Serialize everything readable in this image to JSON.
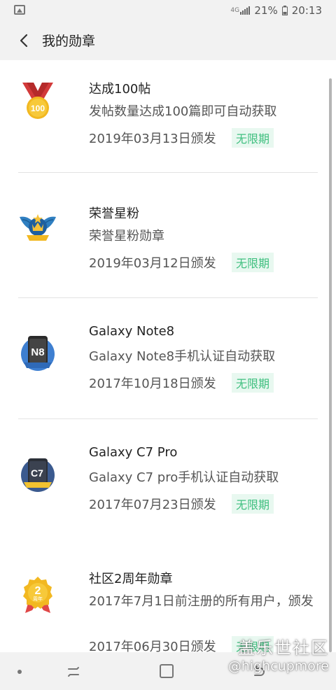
{
  "status": {
    "network": "4G",
    "battery": "21%",
    "time": "20:13"
  },
  "header": {
    "title": "我的勋章"
  },
  "badges": [
    {
      "title": "达成100帖",
      "desc": "发帖数量达成100篇即可自动获取",
      "date": "2019年03月13日颁发",
      "validity": "无限期",
      "icon": "medal-100-icon",
      "icon_text": "100"
    },
    {
      "title": "荣誉星粉",
      "desc": "荣誉星粉勋章",
      "date": "2019年03月12日颁发",
      "validity": "无限期",
      "icon": "winged-crown-icon"
    },
    {
      "title": "Galaxy Note8",
      "desc": "Galaxy Note8手机认证自动获取",
      "date": "2017年10月18日颁发",
      "validity": "无限期",
      "icon": "note8-phone-badge-icon",
      "icon_text": "N8"
    },
    {
      "title": "Galaxy C7 Pro",
      "desc": "Galaxy C7 pro手机认证自动获取",
      "date": "2017年07月23日颁发",
      "validity": "无限期",
      "icon": "c7-phone-badge-icon",
      "icon_text": "C7"
    },
    {
      "title": "社区2周年勋章",
      "desc": "2017年7月1日前注册的所有用户，颁发",
      "date": "2017年06月30日颁发",
      "validity": "无限期",
      "icon": "anniversary-2-icon",
      "icon_text": "2",
      "icon_subtext": "周年"
    }
  ],
  "watermark": {
    "name": "盖乐世社区",
    "user": "@highcupmore"
  },
  "colors": {
    "tag_text": "#3fbf7f",
    "tag_bg": "#e8f8f0"
  }
}
